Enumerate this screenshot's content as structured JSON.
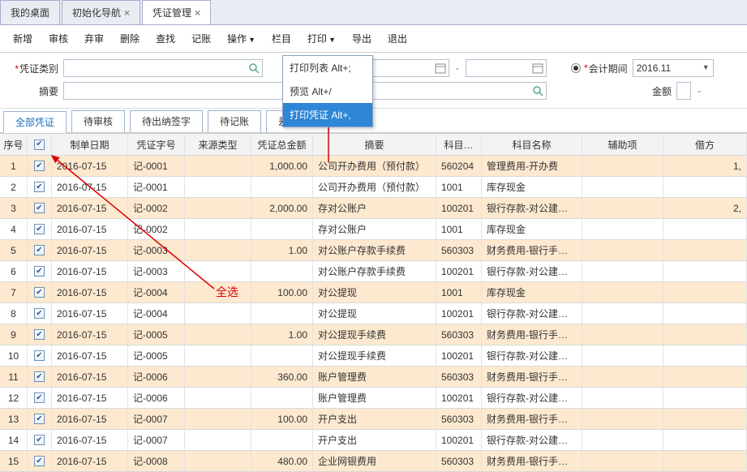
{
  "tabs": [
    {
      "label": "我的桌面",
      "closable": false
    },
    {
      "label": "初始化导航",
      "closable": true
    },
    {
      "label": "凭证管理",
      "closable": true,
      "active": true
    }
  ],
  "toolbar": {
    "new": "新增",
    "audit": "审核",
    "unaudit": "弃审",
    "delete": "删除",
    "query": "查找",
    "journal": "记账",
    "op": "操作",
    "col": "栏目",
    "print": "打印",
    "export": "导出",
    "exit": "退出"
  },
  "filters": {
    "voucher_type_label": "凭证类别",
    "summary_label": "摘要",
    "period_label": "会计期间",
    "period_value": "2016.11",
    "amount_label": "金额",
    "dash": "-"
  },
  "print_menu": {
    "list": "打印列表  Alt+;",
    "preview": "预览  Alt+/",
    "print_v": "打印凭证  Alt+,"
  },
  "subtabs": {
    "all": "全部凭证",
    "pending": "待审核",
    "sign": "待出纳签字",
    "journal": "待记账",
    "diff": "差异凭证"
  },
  "annotation": {
    "select_all": "全选"
  },
  "grid": {
    "head": {
      "idx": "序号",
      "date": "制单日期",
      "vno": "凭证字号",
      "src": "来源类型",
      "amt": "凭证总金额",
      "sum": "摘要",
      "sub": "科目…",
      "subn": "科目名称",
      "aux": "辅助项",
      "dr": "借方"
    },
    "rows": [
      {
        "i": 1,
        "sel": true,
        "d": "2016-07-15",
        "v": "记-0001",
        "a": "1,000.00",
        "s": "公司开办费用（预付款）",
        "c": "560204",
        "n": "管理费用-开办费",
        "dr": "1,"
      },
      {
        "i": 2,
        "sel": false,
        "d": "2016-07-15",
        "v": "记-0001",
        "a": "",
        "s": "公司开办费用（预付款）",
        "c": "1001",
        "n": "库存现金",
        "dr": ""
      },
      {
        "i": 3,
        "sel": true,
        "d": "2016-07-15",
        "v": "记-0002",
        "a": "2,000.00",
        "s": "存对公账户",
        "c": "100201",
        "n": "银行存款-对公建…",
        "dr": "2,"
      },
      {
        "i": 4,
        "sel": false,
        "d": "2016-07-15",
        "v": "记-0002",
        "a": "",
        "s": "存对公账户",
        "c": "1001",
        "n": "库存现金",
        "dr": ""
      },
      {
        "i": 5,
        "sel": true,
        "d": "2016-07-15",
        "v": "记-0003",
        "a": "1.00",
        "s": "对公账户存款手续费",
        "c": "560303",
        "n": "财务费用-银行手…",
        "dr": ""
      },
      {
        "i": 6,
        "sel": false,
        "d": "2016-07-15",
        "v": "记-0003",
        "a": "",
        "s": "对公账户存款手续费",
        "c": "100201",
        "n": "银行存款-对公建…",
        "dr": ""
      },
      {
        "i": 7,
        "sel": true,
        "d": "2016-07-15",
        "v": "记-0004",
        "a": "100.00",
        "s": "对公提现",
        "c": "1001",
        "n": "库存现金",
        "dr": ""
      },
      {
        "i": 8,
        "sel": false,
        "d": "2016-07-15",
        "v": "记-0004",
        "a": "",
        "s": "对公提现",
        "c": "100201",
        "n": "银行存款-对公建…",
        "dr": ""
      },
      {
        "i": 9,
        "sel": true,
        "d": "2016-07-15",
        "v": "记-0005",
        "a": "1.00",
        "s": "对公提现手续费",
        "c": "560303",
        "n": "财务费用-银行手…",
        "dr": ""
      },
      {
        "i": 10,
        "sel": false,
        "d": "2016-07-15",
        "v": "记-0005",
        "a": "",
        "s": "对公提现手续费",
        "c": "100201",
        "n": "银行存款-对公建…",
        "dr": ""
      },
      {
        "i": 11,
        "sel": true,
        "d": "2016-07-15",
        "v": "记-0006",
        "a": "360.00",
        "s": "账户管理费",
        "c": "560303",
        "n": "财务费用-银行手…",
        "dr": ""
      },
      {
        "i": 12,
        "sel": false,
        "d": "2016-07-15",
        "v": "记-0006",
        "a": "",
        "s": "账户管理费",
        "c": "100201",
        "n": "银行存款-对公建…",
        "dr": ""
      },
      {
        "i": 13,
        "sel": true,
        "d": "2016-07-15",
        "v": "记-0007",
        "a": "100.00",
        "s": "开户支出",
        "c": "560303",
        "n": "财务费用-银行手…",
        "dr": ""
      },
      {
        "i": 14,
        "sel": false,
        "d": "2016-07-15",
        "v": "记-0007",
        "a": "",
        "s": "开户支出",
        "c": "100201",
        "n": "银行存款-对公建…",
        "dr": ""
      },
      {
        "i": 15,
        "sel": true,
        "d": "2016-07-15",
        "v": "记-0008",
        "a": "480.00",
        "s": "企业网银费用",
        "c": "560303",
        "n": "财务费用-银行手…",
        "dr": ""
      }
    ]
  }
}
